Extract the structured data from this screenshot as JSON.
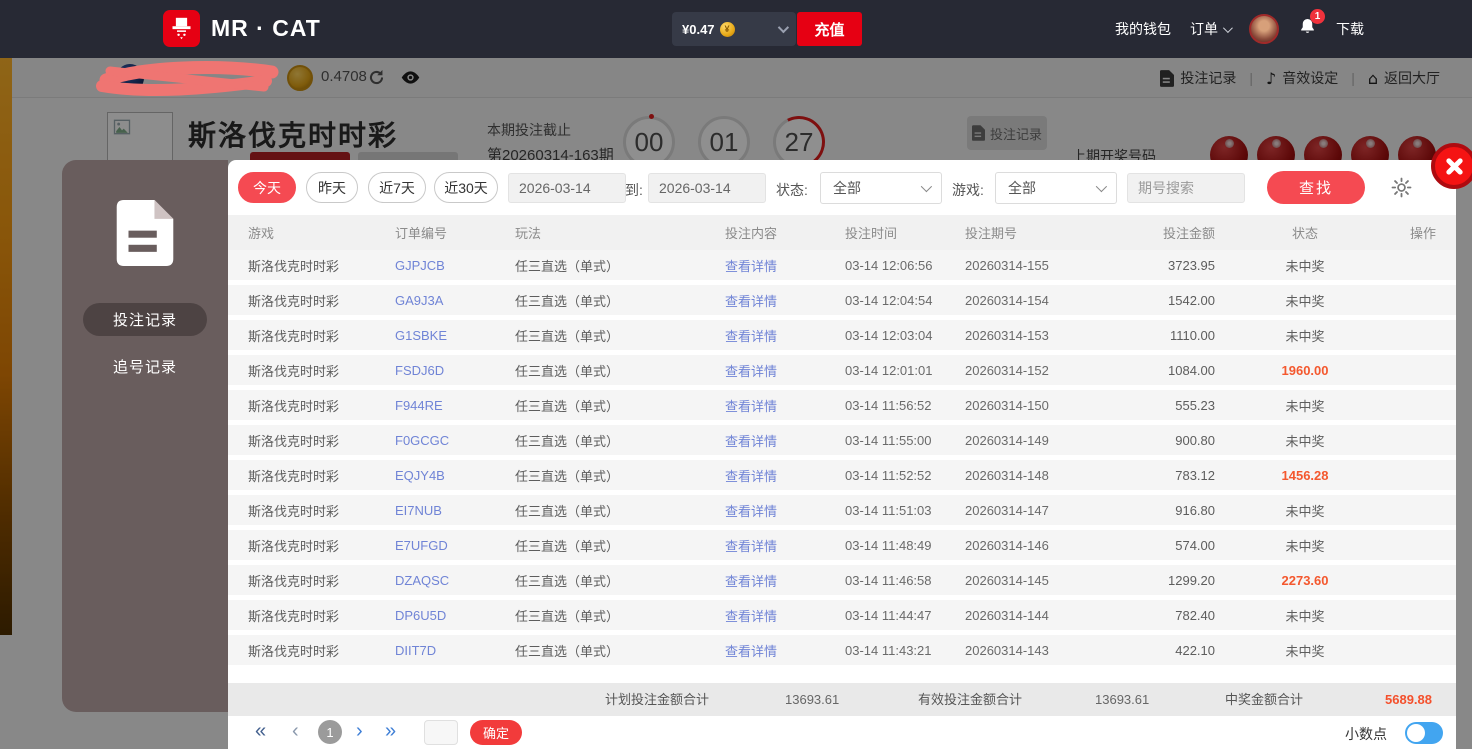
{
  "header": {
    "brand": "MR · CAT",
    "balance": "¥0.47",
    "coin_symbol": "¥",
    "recharge": "充值",
    "wallet": "我的钱包",
    "orders": "订单",
    "download": "下载",
    "notification_count": "1"
  },
  "subheader": {
    "coin_balance": "0.4708",
    "bet_records": "投注记录",
    "sound_settings": "音效设定",
    "back_to_lobby": "返回大厅",
    "home_glyph": "⌂",
    "note_glyph": "♪"
  },
  "game_page": {
    "title": "斯洛伐克时时彩",
    "deadline_label": "本期投注截止",
    "period": "第20260314-163期",
    "countdown": [
      "00",
      "01",
      "27"
    ],
    "records_button": "投注记录",
    "last_draw_label": "上期开奖号码"
  },
  "modal": {
    "tabs": [
      {
        "label": "投注记录"
      },
      {
        "label": "追号记录"
      }
    ],
    "filters": {
      "quick": [
        "今天",
        "昨天",
        "近7天",
        "近30天"
      ],
      "date_from": "2026-03-14",
      "to_label": "到:",
      "date_to": "2026-03-14",
      "status_label": "状态:",
      "status_value": "全部",
      "game_label": "游戏:",
      "game_value": "全部",
      "search_placeholder": "期号搜索",
      "search_button": "查找"
    },
    "table": {
      "columns": [
        "游戏",
        "订单编号",
        "玩法",
        "投注内容",
        "投注时间",
        "投注期号",
        "投注金额",
        "状态",
        "操作"
      ],
      "rows": [
        {
          "game": "斯洛伐克时时彩",
          "order_id": "GJPJCB",
          "play": "任三直选（单式）",
          "detail": "查看详情",
          "time": "03-14 12:06:56",
          "period": "20260314-155",
          "amount": "3723.95",
          "status": "未中奖",
          "win": false
        },
        {
          "game": "斯洛伐克时时彩",
          "order_id": "GA9J3A",
          "play": "任三直选（单式）",
          "detail": "查看详情",
          "time": "03-14 12:04:54",
          "period": "20260314-154",
          "amount": "1542.00",
          "status": "未中奖",
          "win": false
        },
        {
          "game": "斯洛伐克时时彩",
          "order_id": "G1SBKE",
          "play": "任三直选（单式）",
          "detail": "查看详情",
          "time": "03-14 12:03:04",
          "period": "20260314-153",
          "amount": "1110.00",
          "status": "未中奖",
          "win": false
        },
        {
          "game": "斯洛伐克时时彩",
          "order_id": "FSDJ6D",
          "play": "任三直选（单式）",
          "detail": "查看详情",
          "time": "03-14 12:01:01",
          "period": "20260314-152",
          "amount": "1084.00",
          "status": "1960.00",
          "win": true
        },
        {
          "game": "斯洛伐克时时彩",
          "order_id": "F944RE",
          "play": "任三直选（单式）",
          "detail": "查看详情",
          "time": "03-14 11:56:52",
          "period": "20260314-150",
          "amount": "555.23",
          "status": "未中奖",
          "win": false
        },
        {
          "game": "斯洛伐克时时彩",
          "order_id": "F0GCGC",
          "play": "任三直选（单式）",
          "detail": "查看详情",
          "time": "03-14 11:55:00",
          "period": "20260314-149",
          "amount": "900.80",
          "status": "未中奖",
          "win": false
        },
        {
          "game": "斯洛伐克时时彩",
          "order_id": "EQJY4B",
          "play": "任三直选（单式）",
          "detail": "查看详情",
          "time": "03-14 11:52:52",
          "period": "20260314-148",
          "amount": "783.12",
          "status": "1456.28",
          "win": true
        },
        {
          "game": "斯洛伐克时时彩",
          "order_id": "EI7NUB",
          "play": "任三直选（单式）",
          "detail": "查看详情",
          "time": "03-14 11:51:03",
          "period": "20260314-147",
          "amount": "916.80",
          "status": "未中奖",
          "win": false
        },
        {
          "game": "斯洛伐克时时彩",
          "order_id": "E7UFGD",
          "play": "任三直选（单式）",
          "detail": "查看详情",
          "time": "03-14 11:48:49",
          "period": "20260314-146",
          "amount": "574.00",
          "status": "未中奖",
          "win": false
        },
        {
          "game": "斯洛伐克时时彩",
          "order_id": "DZAQSC",
          "play": "任三直选（单式）",
          "detail": "查看详情",
          "time": "03-14 11:46:58",
          "period": "20260314-145",
          "amount": "1299.20",
          "status": "2273.60",
          "win": true
        },
        {
          "game": "斯洛伐克时时彩",
          "order_id": "DP6U5D",
          "play": "任三直选（单式）",
          "detail": "查看详情",
          "time": "03-14 11:44:47",
          "period": "20260314-144",
          "amount": "782.40",
          "status": "未中奖",
          "win": false
        },
        {
          "game": "斯洛伐克时时彩",
          "order_id": "DIIT7D",
          "play": "任三直选（单式）",
          "detail": "查看详情",
          "time": "03-14 11:43:21",
          "period": "20260314-143",
          "amount": "422.10",
          "status": "未中奖",
          "win": false
        }
      ]
    },
    "totals": {
      "planned_label": "计划投注金额合计",
      "planned_value": "13693.61",
      "valid_label": "有效投注金额合计",
      "valid_value": "13693.61",
      "win_label": "中奖金额合计",
      "win_value": "5689.88"
    },
    "pagination": {
      "first": "«",
      "prev": "‹",
      "current": "1",
      "next": "›",
      "last": "»",
      "confirm": "确定"
    },
    "decimal_label": "小数点"
  }
}
